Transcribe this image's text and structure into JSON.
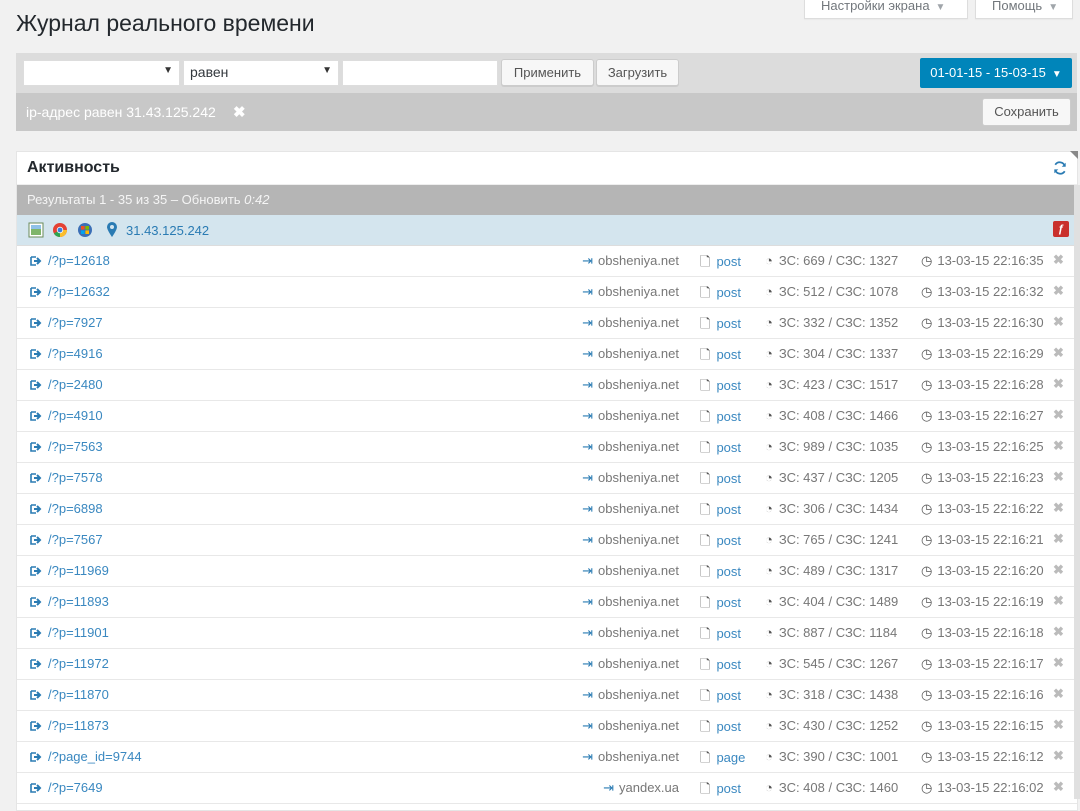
{
  "page": {
    "title": "Журнал реального времени"
  },
  "top_tabs": {
    "screen_options": "Настройки экрана",
    "help": "Помощь"
  },
  "filter": {
    "field_value": "",
    "operator_value": "равен",
    "text_value": "",
    "apply_label": "Применить",
    "load_label": "Загрузить",
    "date_range": "01-01-15 - 15-03-15"
  },
  "condition": {
    "text": "ip-адрес равен 31.43.125.242",
    "save_label": "Сохранить"
  },
  "panel": {
    "title": "Активность",
    "results_text": "Результаты 1 - 35 из 35 – Обновить",
    "results_timer": "0:42"
  },
  "visitor": {
    "ip": "31.43.125.242"
  },
  "rows": [
    {
      "url": "/?p=12618",
      "referrer": "obsheniya.net",
      "type": "post",
      "stats": "ЗС: 669 / СЗС: 1327",
      "time": "13-03-15 22:16:35"
    },
    {
      "url": "/?p=12632",
      "referrer": "obsheniya.net",
      "type": "post",
      "stats": "ЗС: 512 / СЗС: 1078",
      "time": "13-03-15 22:16:32"
    },
    {
      "url": "/?p=7927",
      "referrer": "obsheniya.net",
      "type": "post",
      "stats": "ЗС: 332 / СЗС: 1352",
      "time": "13-03-15 22:16:30"
    },
    {
      "url": "/?p=4916",
      "referrer": "obsheniya.net",
      "type": "post",
      "stats": "ЗС: 304 / СЗС: 1337",
      "time": "13-03-15 22:16:29"
    },
    {
      "url": "/?p=2480",
      "referrer": "obsheniya.net",
      "type": "post",
      "stats": "ЗС: 423 / СЗС: 1517",
      "time": "13-03-15 22:16:28"
    },
    {
      "url": "/?p=4910",
      "referrer": "obsheniya.net",
      "type": "post",
      "stats": "ЗС: 408 / СЗС: 1466",
      "time": "13-03-15 22:16:27"
    },
    {
      "url": "/?p=7563",
      "referrer": "obsheniya.net",
      "type": "post",
      "stats": "ЗС: 989 / СЗС: 1035",
      "time": "13-03-15 22:16:25"
    },
    {
      "url": "/?p=7578",
      "referrer": "obsheniya.net",
      "type": "post",
      "stats": "ЗС: 437 / СЗС: 1205",
      "time": "13-03-15 22:16:23"
    },
    {
      "url": "/?p=6898",
      "referrer": "obsheniya.net",
      "type": "post",
      "stats": "ЗС: 306 / СЗС: 1434",
      "time": "13-03-15 22:16:22"
    },
    {
      "url": "/?p=7567",
      "referrer": "obsheniya.net",
      "type": "post",
      "stats": "ЗС: 765 / СЗС: 1241",
      "time": "13-03-15 22:16:21"
    },
    {
      "url": "/?p=11969",
      "referrer": "obsheniya.net",
      "type": "post",
      "stats": "ЗС: 489 / СЗС: 1317",
      "time": "13-03-15 22:16:20"
    },
    {
      "url": "/?p=11893",
      "referrer": "obsheniya.net",
      "type": "post",
      "stats": "ЗС: 404 / СЗС: 1489",
      "time": "13-03-15 22:16:19"
    },
    {
      "url": "/?p=11901",
      "referrer": "obsheniya.net",
      "type": "post",
      "stats": "ЗС: 887 / СЗС: 1184",
      "time": "13-03-15 22:16:18"
    },
    {
      "url": "/?p=11972",
      "referrer": "obsheniya.net",
      "type": "post",
      "stats": "ЗС: 545 / СЗС: 1267",
      "time": "13-03-15 22:16:17"
    },
    {
      "url": "/?p=11870",
      "referrer": "obsheniya.net",
      "type": "post",
      "stats": "ЗС: 318 / СЗС: 1438",
      "time": "13-03-15 22:16:16"
    },
    {
      "url": "/?p=11873",
      "referrer": "obsheniya.net",
      "type": "post",
      "stats": "ЗС: 430 / СЗС: 1252",
      "time": "13-03-15 22:16:15"
    },
    {
      "url": "/?page_id=9744",
      "referrer": "obsheniya.net",
      "type": "page",
      "stats": "ЗС: 390 / СЗС: 1001",
      "time": "13-03-15 22:16:12"
    },
    {
      "url": "/?p=7649",
      "referrer": "yandex.ua",
      "type": "post",
      "stats": "ЗС: 408 / СЗС: 1460",
      "time": "13-03-15 22:16:02"
    }
  ]
}
